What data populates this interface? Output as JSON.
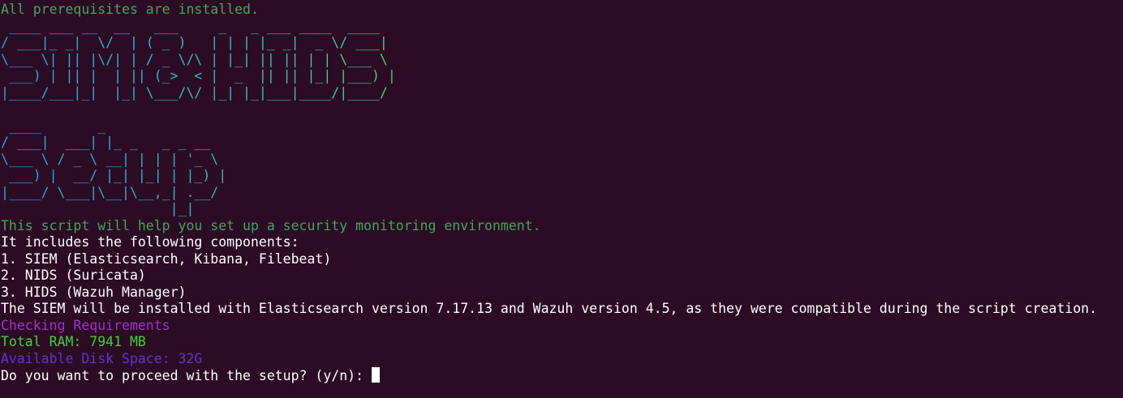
{
  "terminal": {
    "background": "#2c0b24",
    "lines": {
      "prereq": {
        "text": "All prerequisites are installed.",
        "color": "#3fa95c"
      },
      "intro": {
        "text": "This script will help you set up a security monitoring environment.",
        "color": "#3fa95c"
      },
      "includes": {
        "text": "It includes the following components:",
        "color": "#ffffff"
      },
      "comp1": {
        "text": "1. SIEM (Elasticsearch, Kibana, Filebeat)",
        "color": "#ffffff"
      },
      "comp2": {
        "text": "2. NIDS (Suricata)",
        "color": "#ffffff"
      },
      "comp3": {
        "text": "3. HIDS (Wazuh Manager)",
        "color": "#ffffff"
      },
      "version": {
        "text": "The SIEM will be installed with Elasticsearch version 7.17.13 and Wazuh version 4.5, as they were compatible during the script creation.",
        "color": "#ffffff"
      },
      "checking": {
        "text": "Checking Requirements",
        "color": "#a230c8"
      },
      "ram": {
        "text": "Total RAM: 7941 MB",
        "color": "#42d13a"
      },
      "disk": {
        "text": "Available Disk Space: 32G",
        "color": "#6a2fd0"
      },
      "prompt": {
        "text": "Do you want to proceed with the setup? (y/n): ",
        "color": "#ffffff"
      }
    },
    "banner_title": " ____ ___ __  __   ___     _   _ ___ ____  ____  \n/ ___|_ _|  \\/  | ( _ )   | | | |_ _|  _ \\/ ___| \n\\___ \\| || |\\/| | / _ \\/\\ | |_| || || | | \\___ \\ \n ___) | || |  | || (_>  < |  _  || || |_| |___) |\n|____/___|_|  |_| \\___/\\/ |_| |_|___|____/|____/ ",
    "banner_setup": " ____       _               \n/ ___|  ___| |_ _   _ _ __  \n\\___ \\ / _ \\ __| | | | '_ \\ \n ___) |  __/ |_| |_| | |_) |\n|____/ \\___|\\__|\\__,_| .__/ \n                     |_|    ",
    "gradient_colors": [
      "#2fa4e6",
      "#3cc7b0",
      "#8bd33a",
      "#d8d62a",
      "#f0c43a"
    ]
  }
}
